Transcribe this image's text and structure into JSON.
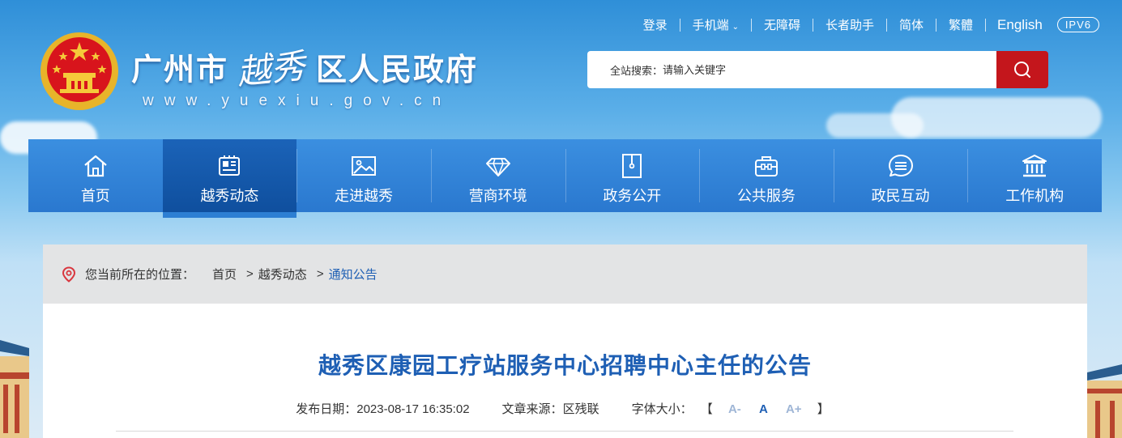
{
  "header": {
    "title_prefix": "广州市",
    "title_calligraphy": "越秀",
    "title_suffix": "区人民政府",
    "site_url": "www.yuexiu.gov.cn"
  },
  "top_links": {
    "login": "登录",
    "mobile": "手机端",
    "accessibility": "无障碍",
    "elderly": "长者助手",
    "simplified": "简体",
    "traditional": "繁體",
    "english": "English",
    "ipv6": "IPV6"
  },
  "search": {
    "label": "全站搜索：",
    "placeholder": "请输入关键字"
  },
  "nav": {
    "items": [
      {
        "label": "首页",
        "icon": "home-icon"
      },
      {
        "label": "越秀动态",
        "icon": "newspaper-icon"
      },
      {
        "label": "走进越秀",
        "icon": "picture-icon"
      },
      {
        "label": "营商环境",
        "icon": "diamond-icon"
      },
      {
        "label": "政务公开",
        "icon": "document-folder-icon"
      },
      {
        "label": "公共服务",
        "icon": "briefcase-icon"
      },
      {
        "label": "政民互动",
        "icon": "chat-icon"
      },
      {
        "label": "工作机构",
        "icon": "institution-icon"
      }
    ],
    "active_index": 1
  },
  "breadcrumb": {
    "prefix": "您当前所在的位置：",
    "items": [
      "首页",
      "越秀动态"
    ],
    "separator": ">",
    "current": "通知公告"
  },
  "article": {
    "title": "越秀区康园工疗站服务中心招聘中心主任的公告",
    "date_label": "发布日期：",
    "date": "2023-08-17 16:35:02",
    "source_label": "文章来源：",
    "source": "区残联",
    "font_size_label": "字体大小：",
    "bracket_open": "【",
    "bracket_close": "】",
    "font_small": "A-",
    "font_normal": "A",
    "font_large": "A+"
  },
  "colors": {
    "nav_bg": "#2a78cf",
    "nav_active": "#0f4f9e",
    "search_button": "#c4161c",
    "title_blue": "#1e5fb4"
  }
}
